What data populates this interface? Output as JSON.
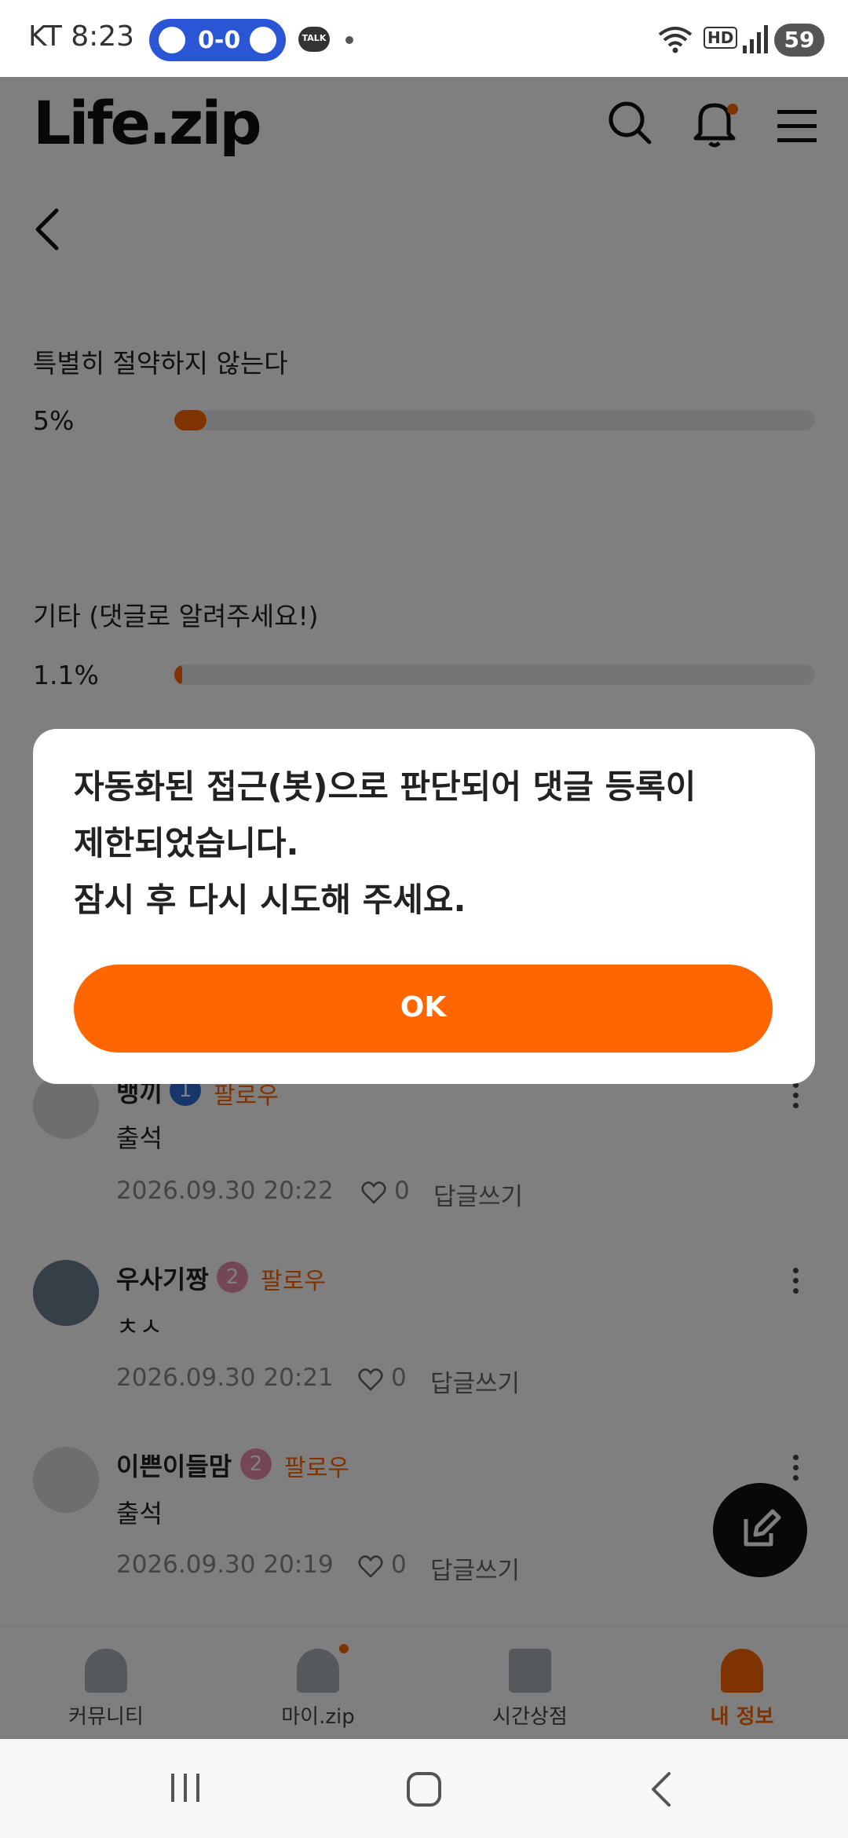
{
  "status_bar": {
    "carrier_time": "KT 8:23",
    "score": "0-0",
    "talk_label": "TALK",
    "hd_label": "HD",
    "battery": "59"
  },
  "header": {
    "logo": "Life.zip"
  },
  "poll": {
    "options": [
      {
        "label": "특별히 절약하지 않는다",
        "percent_text": "5%",
        "fraction": 0.05
      },
      {
        "label": "기타 (댓글로 알려주세요!)",
        "percent_text": "1.1%",
        "fraction": 0.011
      }
    ]
  },
  "comments": [
    {
      "name": "뱅끼",
      "level": "1",
      "follow": "팔로우",
      "body": "출석",
      "timestamp": "2026.09.30 20:22",
      "likes": "0",
      "reply": "답글쓰기"
    },
    {
      "name": "우사기짱",
      "level": "2",
      "follow": "팔로우",
      "body": "ㅊㅅ",
      "timestamp": "2026.09.30 20:21",
      "likes": "0",
      "reply": "답글쓰기"
    },
    {
      "name": "이쁜이들맘",
      "level": "2",
      "follow": "팔로우",
      "body": "출석",
      "timestamp": "2026.09.30 20:19",
      "likes": "0",
      "reply": "답글쓰기"
    }
  ],
  "bottom_nav": [
    {
      "label": "커뮤니티",
      "icon": "community-icon",
      "active": false
    },
    {
      "label": "마이.zip",
      "icon": "myzip-icon",
      "active": false
    },
    {
      "label": "시간상점",
      "icon": "gift-icon",
      "active": false
    },
    {
      "label": "내 정보",
      "icon": "profile-icon",
      "active": true
    }
  ],
  "dialog": {
    "message": "자동화된 접근(봇)으로 판단되어 댓글 등록이\n제한되었습니다.\n잠시 후 다시 시도해 주세요.",
    "ok_label": "OK"
  },
  "colors": {
    "accent": "#ff6600",
    "score_pill": "#2a56d6",
    "level1": "#2f6fd6",
    "level2": "#e88fb0"
  }
}
